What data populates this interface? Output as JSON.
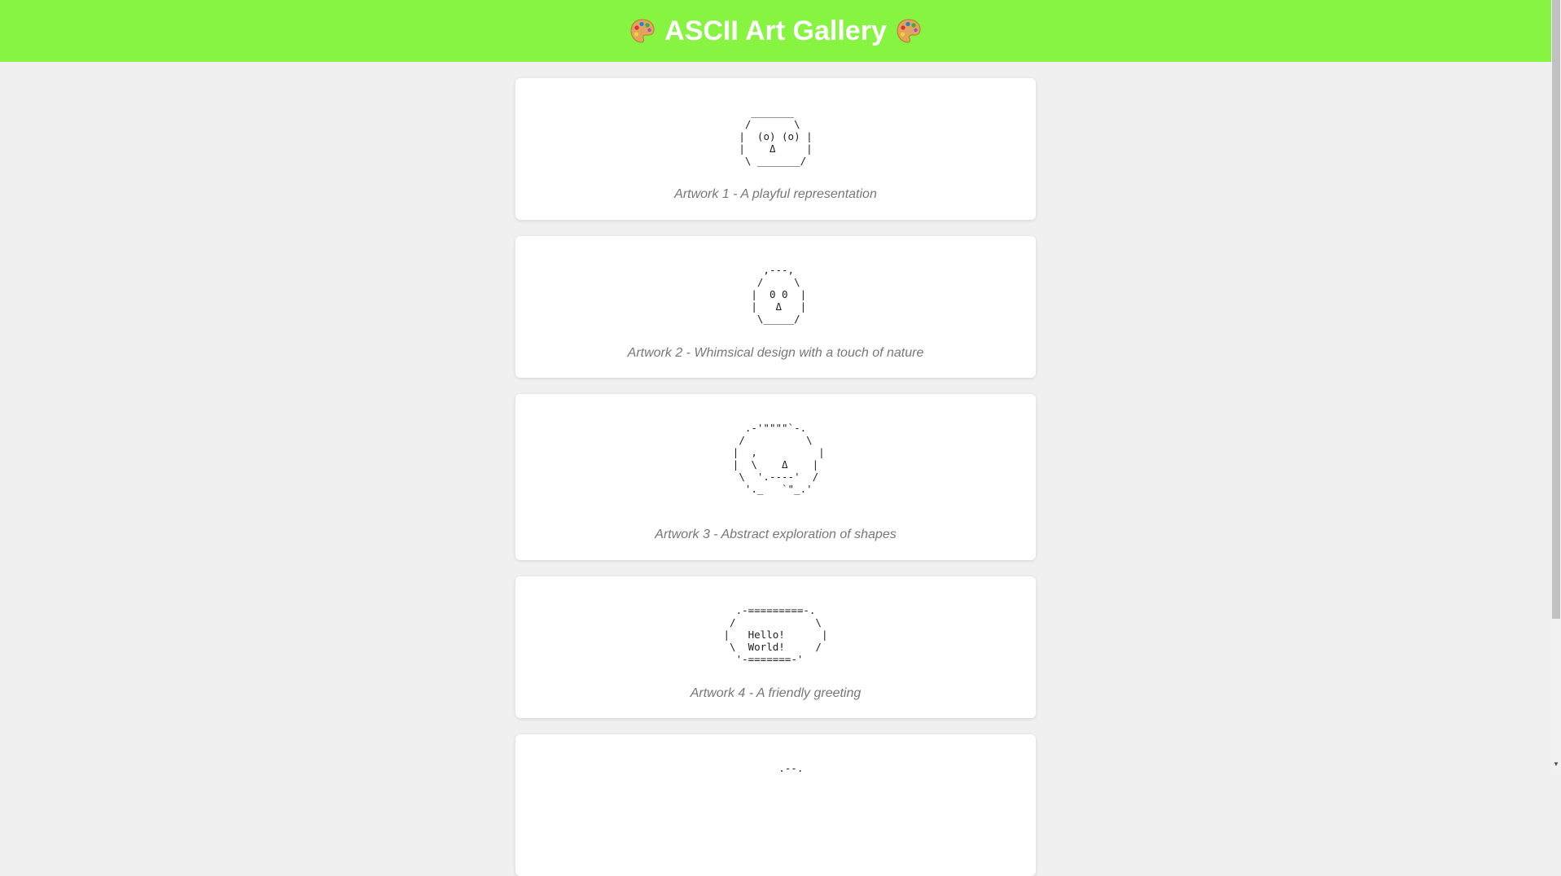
{
  "header": {
    "title": "ASCII Art Gallery",
    "bg_color": "#87f442",
    "left_icon": "palette-icon",
    "right_icon": "palette-icon"
  },
  "artworks": [
    {
      "art": "  _______\n /       \\\n|  (o) (o) |\n|    Δ     |\n \\ _______/",
      "caption": "Artwork 1 - A playful representation"
    },
    {
      "art": "   ,---,\n  /     \\\n |  0 0  |\n |   Δ   |\n  \\_____/",
      "caption": "Artwork 2 - Whimsical design with a touch of nature"
    },
    {
      "art": "   .-'\"\"\"\"`-.\n  /          \\\n |  ,          |\n |  \\    Δ    |\n  \\  '.----'  /\n   '._   `\"_.'",
      "caption": "Artwork 3 - Abstract exploration of shapes"
    },
    {
      "art": "  .-=========-.\n /             \\\n|   Hello!      |\n \\  World!     /\n  '-=======-'",
      "caption": "Artwork 4 - A friendly greeting"
    },
    {
      "art": "     .--.",
      "caption": ""
    }
  ]
}
